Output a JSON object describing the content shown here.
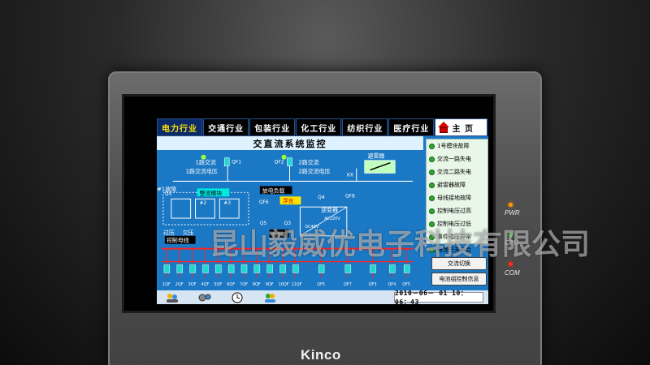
{
  "tabs": [
    {
      "label": "电力行业",
      "active": true
    },
    {
      "label": "交通行业"
    },
    {
      "label": "包装行业"
    },
    {
      "label": "化工行业"
    },
    {
      "label": "纺织行业"
    },
    {
      "label": "医疗行业"
    },
    {
      "label": "主 页",
      "icon": "home-icon"
    }
  ],
  "title": "交直流系统监控",
  "diagram": {
    "switches_top": [
      "QF1",
      "QF2"
    ],
    "line1": "1路交流",
    "line2": "2路交流",
    "line1_voltage": "1路交流电压",
    "line2_voltage": "2路交流电压",
    "q4": "Q4",
    "fault1": "#1故障",
    "rectifier_module": "整流模块",
    "rect_cells": [
      "#2",
      "#3"
    ],
    "discharge_load": "放电负载",
    "qf6": "QF6",
    "float_charge": "浮充",
    "q5": "Q5",
    "q3": "Q3",
    "surge": "避雷器",
    "kx": "KX",
    "q4b": "Q4",
    "qf8": "QF8",
    "inverter": "逆变器",
    "ac_volt": "AC220V",
    "dc_volt": "DC48V",
    "overvolt": "过压",
    "undervolt": "欠压",
    "ctrl_bus": "控制母线",
    "battery_group": "电池组",
    "feeder_labels": [
      "1QF",
      "2QF",
      "3QF",
      "4QF",
      "5QF",
      "6QF",
      "7QF",
      "8QF",
      "9QF",
      "10QF",
      "11QF",
      "QF5",
      "QF7",
      "QF3",
      "QF4",
      "QF5"
    ]
  },
  "faults": [
    "1号模块故障",
    "交流一路失电",
    "交流二路失电",
    "避雷器故障",
    "母线接地故障",
    "控制电压过高",
    "控制电压过低",
    "事件电压异常",
    "电池开关未合"
  ],
  "buttons": {
    "switch": "交流切换",
    "battery_info": "电池组控制信息"
  },
  "status_icons": [
    "users-icon",
    "gears-icon",
    "clock-icon",
    "people-icon"
  ],
  "datetime": "2010－06－ 01   10：06：43",
  "indicators": [
    {
      "label": "PWR",
      "color": "#ff9a00"
    },
    {
      "label": "CPU",
      "color": "#34d13a"
    },
    {
      "label": "COM",
      "color": "#ff2a1a"
    }
  ],
  "brand": "Kinco",
  "watermark": "昆山毅威优电子科技有限公司"
}
